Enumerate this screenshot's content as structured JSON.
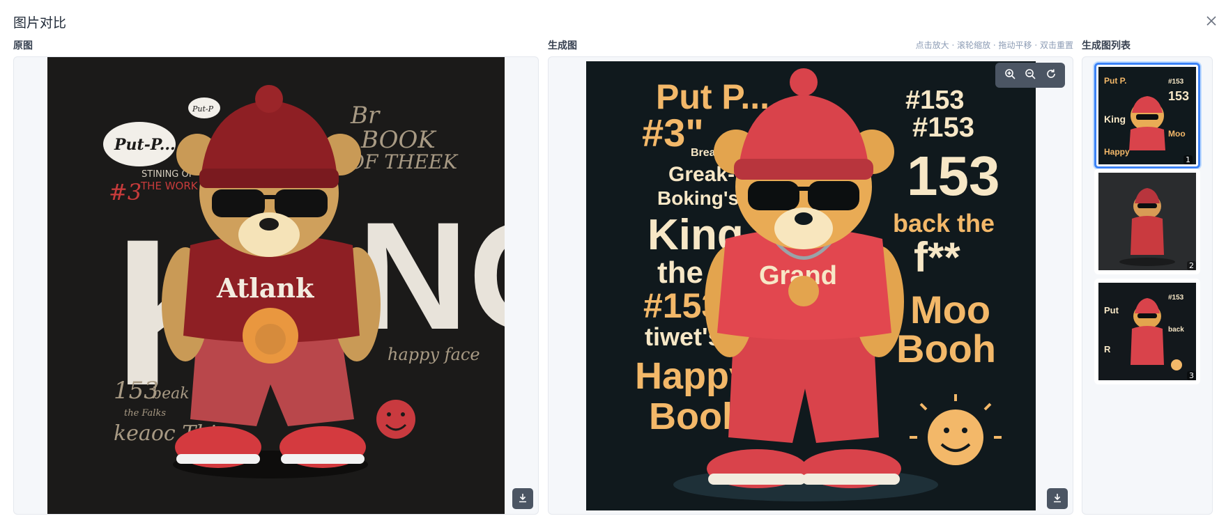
{
  "dialog": {
    "title": "图片对比"
  },
  "original": {
    "label": "原图"
  },
  "generated": {
    "label": "生成图",
    "hint": "点击放大 · 滚轮缩放 · 拖动平移 · 双击重置"
  },
  "list": {
    "label": "生成图列表"
  },
  "thumbs": [
    {
      "num": "1",
      "active": true
    },
    {
      "num": "2",
      "active": false
    },
    {
      "num": "3",
      "active": false
    }
  ],
  "original_art": {
    "bubble": "Put-P...",
    "small_bubble": "Put-P",
    "left_lines": [
      "#3",
      "STINING OF",
      "THE WORK"
    ],
    "big_word": [
      "K",
      "NG"
    ],
    "shirt": "Atlank",
    "top_right": [
      "Br",
      "BOOK",
      "OF THEEK"
    ],
    "happy": "happy face",
    "bottom_left": [
      "153",
      "beak",
      "the Falks",
      "keaoc Thine"
    ]
  },
  "generated_art": {
    "left_lines": [
      "Put P...",
      "#3\"",
      "Breant*",
      "Greak-",
      "Boking's",
      "King",
      "the",
      "#153\"",
      "tiwet's",
      "Happy",
      "Booh"
    ],
    "right_lines": [
      "#153",
      "#153",
      "153",
      "back the",
      "f**",
      "Moo",
      "Booh"
    ],
    "shirt": "Grand"
  },
  "colors": {
    "accent": "#3b82f6",
    "panel_bg": "#f5f7fa",
    "orig_bg": "#1b1a19",
    "gen_bg": "#10191d",
    "cream": "#f7e7c6",
    "orange": "#f3b869",
    "red": "#c93a3f"
  },
  "icons": [
    "close-icon",
    "download-icon",
    "zoom-in-icon",
    "zoom-out-icon",
    "reset-icon"
  ]
}
